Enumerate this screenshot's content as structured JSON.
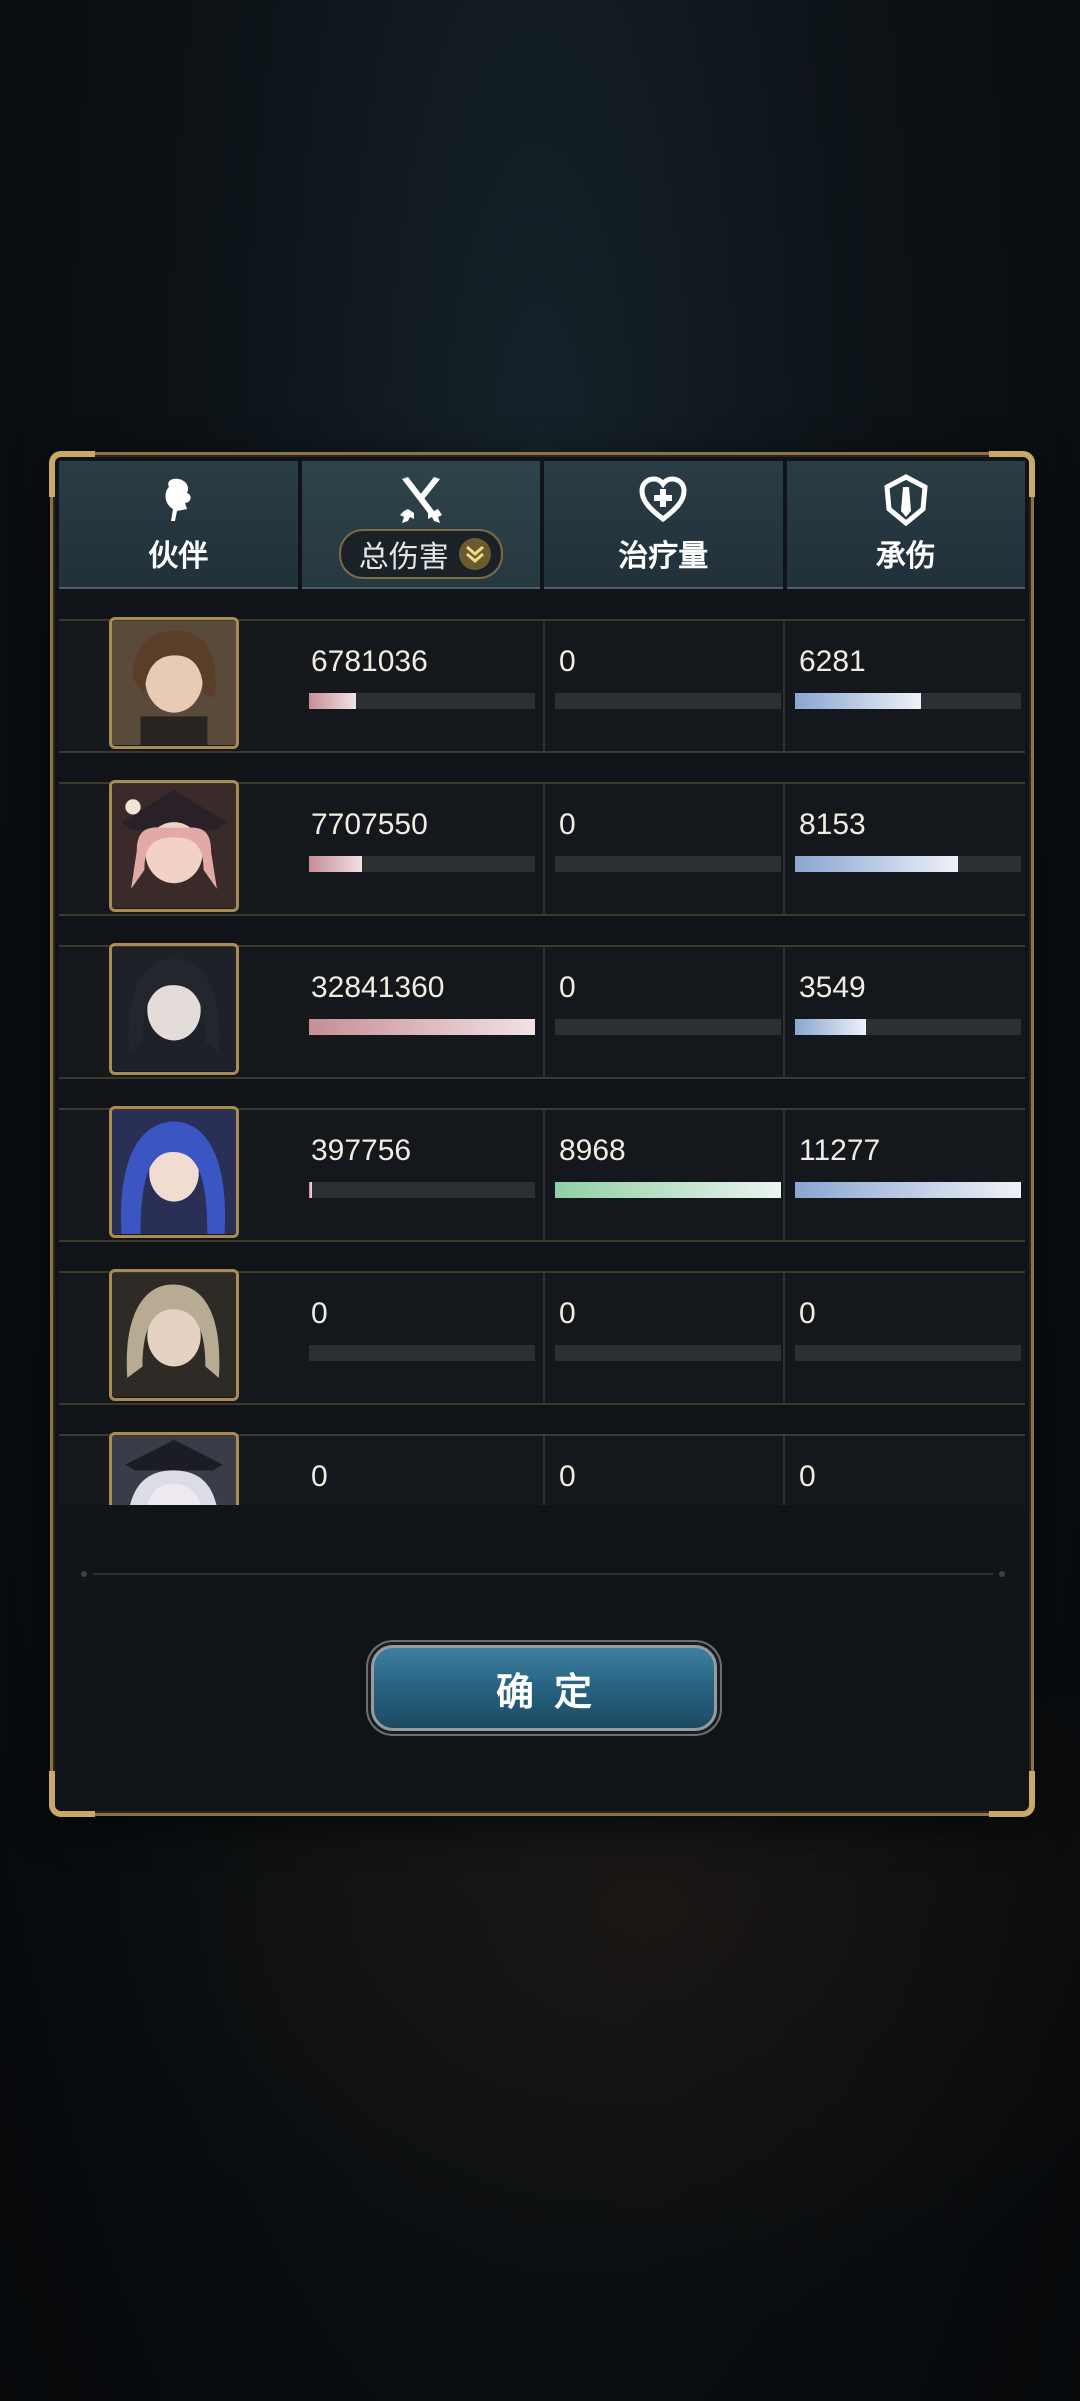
{
  "tabs": [
    {
      "label": "伙伴",
      "icon": "partner-icon"
    },
    {
      "label": "总伤害",
      "icon": "crossed-swords-icon",
      "sort_icon": "chevron-down-icon"
    },
    {
      "label": "治疗量",
      "icon": "heart-plus-icon"
    },
    {
      "label": "承伤",
      "icon": "shield-icon"
    }
  ],
  "rows": [
    {
      "portrait": "brown-hair-girl-portrait",
      "damage": "6781036",
      "healing": "0",
      "taken": "6281",
      "damage_ratio": 0.206,
      "healing_ratio": 0,
      "taken_ratio": 0.557
    },
    {
      "portrait": "pink-hair-witch-portrait",
      "damage": "7707550",
      "healing": "0",
      "taken": "8153",
      "damage_ratio": 0.235,
      "healing_ratio": 0,
      "taken_ratio": 0.723
    },
    {
      "portrait": "dark-hair-girl-portrait",
      "damage": "32841360",
      "healing": "0",
      "taken": "3549",
      "damage_ratio": 1.0,
      "healing_ratio": 0,
      "taken_ratio": 0.315
    },
    {
      "portrait": "blue-hair-girl-portrait",
      "damage": "397756",
      "healing": "8968",
      "taken": "11277",
      "damage_ratio": 0.012,
      "healing_ratio": 1.0,
      "taken_ratio": 1.0
    },
    {
      "portrait": "blonde-hair-girl-portrait",
      "damage": "0",
      "healing": "0",
      "taken": "0",
      "damage_ratio": 0,
      "healing_ratio": 0,
      "taken_ratio": 0
    },
    {
      "portrait": "white-hair-girl-portrait",
      "damage": "0",
      "healing": "0",
      "taken": "0",
      "damage_ratio": 0,
      "healing_ratio": 0,
      "taken_ratio": 0
    }
  ],
  "confirm_label": "确定",
  "colors": {
    "frame_gold": "#c9a86a",
    "damage_bar": "#c78e95",
    "healing_bar": "#8fd0a4",
    "taken_bar": "#8aa5d2"
  }
}
